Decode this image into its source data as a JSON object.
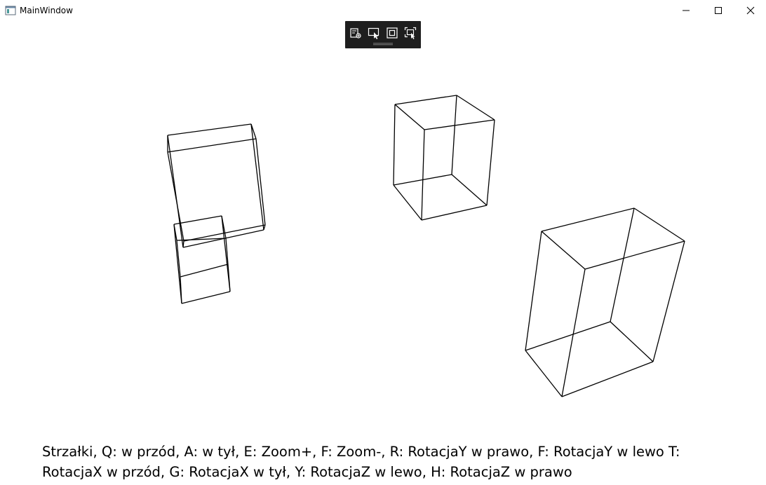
{
  "window": {
    "title": "MainWindow"
  },
  "icons": {
    "app": "window-app-icon",
    "minimize": "minimize-icon",
    "maximize": "maximize-icon",
    "close": "close-icon",
    "toolbar": [
      "live-visual-tree-icon",
      "select-element-icon",
      "display-layout-adorners-icon",
      "track-focused-element-icon"
    ]
  },
  "instructions": {
    "line1": "Strzałki, Q: w przód, A: w tył, E: Zoom+, F: Zoom-, R: RotacjaY w prawo, F: RotacjaY w lewo T:",
    "line2": "RotacjaX w przód, G: RotacjaX w tył, Y: RotacjaZ w lewo, H: RotacjaZ w prawo"
  },
  "colors": {
    "background": "#ffffff",
    "wireframe": "#000000",
    "toolbar": "#1e1e1e",
    "toolbar_icon": "#ffffff"
  }
}
